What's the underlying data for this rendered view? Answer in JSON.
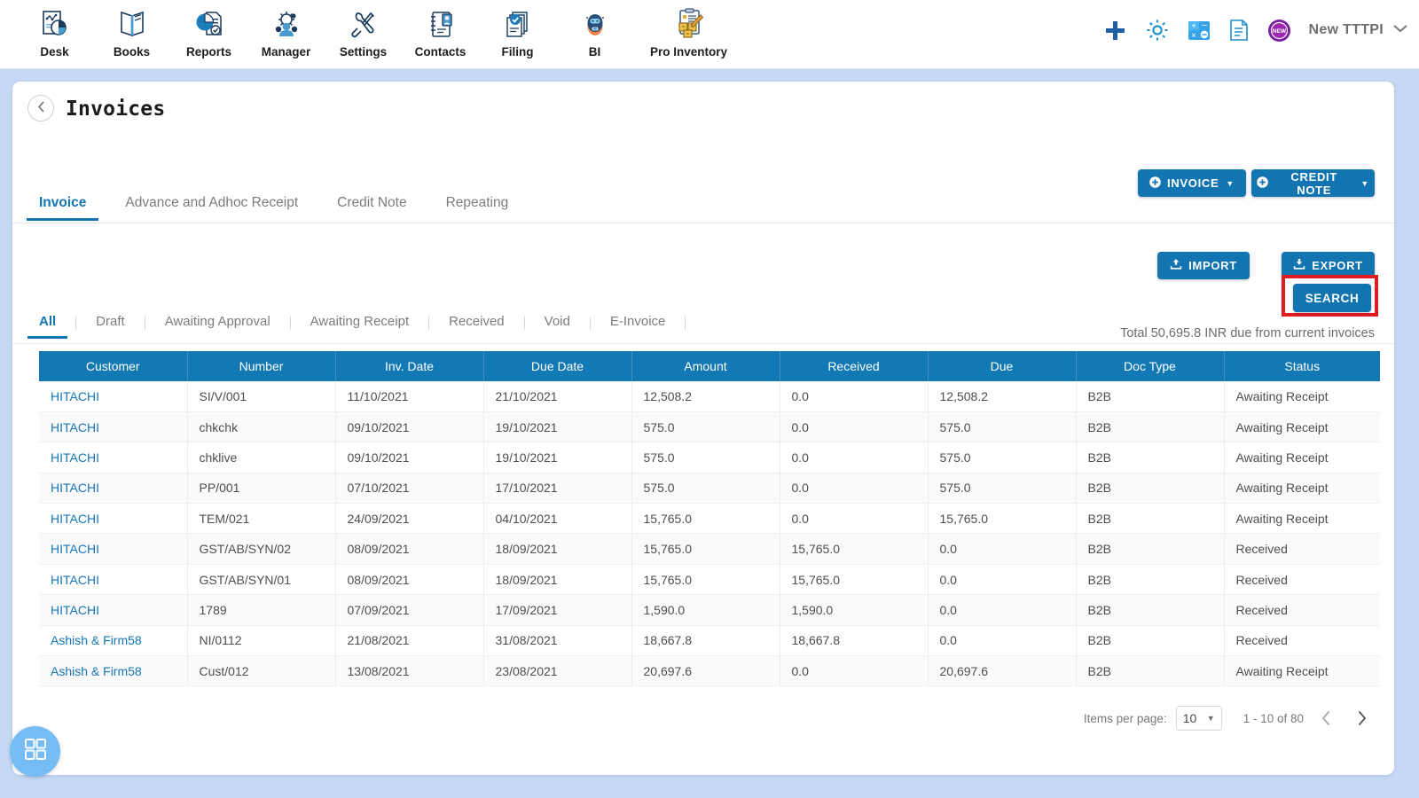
{
  "topnav": {
    "items": [
      {
        "label": "Desk",
        "icon": "dashboard-icon"
      },
      {
        "label": "Books",
        "icon": "books-icon"
      },
      {
        "label": "Reports",
        "icon": "reports-icon"
      },
      {
        "label": "Manager",
        "icon": "manager-icon"
      },
      {
        "label": "Settings",
        "icon": "settings-icon"
      },
      {
        "label": "Contacts",
        "icon": "contacts-icon"
      },
      {
        "label": "Filing",
        "icon": "filing-icon"
      },
      {
        "label": "BI",
        "icon": "bi-robot-icon"
      },
      {
        "label": "Pro Inventory",
        "icon": "pro-inventory-icon"
      }
    ],
    "right": {
      "add_icon": "plus-icon",
      "settings_icon": "gear-icon",
      "calculator_icon": "calculator-icon",
      "notes_icon": "notes-icon",
      "new_badge_icon": "new-badge-icon",
      "org_name": "New TTTPI",
      "org_caret": "chevron-down-icon"
    }
  },
  "page": {
    "back_icon": "chevron-left-icon",
    "title": "Invoices"
  },
  "actions": {
    "invoice_label": "INVOICE",
    "credit_note_label": "CREDIT NOTE",
    "import_label": "IMPORT",
    "export_label": "EXPORT",
    "search_label": "SEARCH",
    "plus_icon": "circle-plus-icon",
    "caret": "▼",
    "upload_icon": "upload-icon"
  },
  "main_tabs": [
    {
      "label": "Invoice",
      "active": true
    },
    {
      "label": "Advance and Adhoc Receipt",
      "active": false
    },
    {
      "label": "Credit Note",
      "active": false
    },
    {
      "label": "Repeating",
      "active": false
    }
  ],
  "filter_tabs": [
    {
      "label": "All",
      "active": true
    },
    {
      "label": "Draft",
      "active": false
    },
    {
      "label": "Awaiting Approval",
      "active": false
    },
    {
      "label": "Awaiting Receipt",
      "active": false
    },
    {
      "label": "Received",
      "active": false
    },
    {
      "label": "Void",
      "active": false
    },
    {
      "label": "E-Invoice",
      "active": false
    }
  ],
  "summary": {
    "total_text": "Total 50,695.8 INR due from current invoices"
  },
  "table": {
    "columns": [
      "Customer",
      "Number",
      "Inv. Date",
      "Due Date",
      "Amount",
      "Received",
      "Due",
      "Doc Type",
      "Status"
    ],
    "rows": [
      {
        "customer": "HITACHI",
        "number": "SI/V/001",
        "inv_date": "11/10/2021",
        "due_date": "21/10/2021",
        "amount": "12,508.2",
        "received": "0.0",
        "due": "12,508.2",
        "doc_type": "B2B",
        "status": "Awaiting Receipt"
      },
      {
        "customer": "HITACHI",
        "number": "chkchk",
        "inv_date": "09/10/2021",
        "due_date": "19/10/2021",
        "amount": "575.0",
        "received": "0.0",
        "due": "575.0",
        "doc_type": "B2B",
        "status": "Awaiting Receipt"
      },
      {
        "customer": "HITACHI",
        "number": "chklive",
        "inv_date": "09/10/2021",
        "due_date": "19/10/2021",
        "amount": "575.0",
        "received": "0.0",
        "due": "575.0",
        "doc_type": "B2B",
        "status": "Awaiting Receipt"
      },
      {
        "customer": "HITACHI",
        "number": "PP/001",
        "inv_date": "07/10/2021",
        "due_date": "17/10/2021",
        "amount": "575.0",
        "received": "0.0",
        "due": "575.0",
        "doc_type": "B2B",
        "status": "Awaiting Receipt"
      },
      {
        "customer": "HITACHI",
        "number": "TEM/021",
        "inv_date": "24/09/2021",
        "due_date": "04/10/2021",
        "amount": "15,765.0",
        "received": "0.0",
        "due": "15,765.0",
        "doc_type": "B2B",
        "status": "Awaiting Receipt"
      },
      {
        "customer": "HITACHI",
        "number": "GST/AB/SYN/02",
        "inv_date": "08/09/2021",
        "due_date": "18/09/2021",
        "amount": "15,765.0",
        "received": "15,765.0",
        "due": "0.0",
        "doc_type": "B2B",
        "status": "Received"
      },
      {
        "customer": "HITACHI",
        "number": "GST/AB/SYN/01",
        "inv_date": "08/09/2021",
        "due_date": "18/09/2021",
        "amount": "15,765.0",
        "received": "15,765.0",
        "due": "0.0",
        "doc_type": "B2B",
        "status": "Received"
      },
      {
        "customer": "HITACHI",
        "number": "1789",
        "inv_date": "07/09/2021",
        "due_date": "17/09/2021",
        "amount": "1,590.0",
        "received": "1,590.0",
        "due": "0.0",
        "doc_type": "B2B",
        "status": "Received"
      },
      {
        "customer": "Ashish & Firm58",
        "number": "NI/0112",
        "inv_date": "21/08/2021",
        "due_date": "31/08/2021",
        "amount": "18,667.8",
        "received": "18,667.8",
        "due": "0.0",
        "doc_type": "B2B",
        "status": "Received"
      },
      {
        "customer": "Ashish & Firm58",
        "number": "Cust/012",
        "inv_date": "13/08/2021",
        "due_date": "23/08/2021",
        "amount": "20,697.6",
        "received": "0.0",
        "due": "20,697.6",
        "doc_type": "B2B",
        "status": "Awaiting Receipt"
      }
    ]
  },
  "pagination": {
    "items_per_page_label": "Items per page:",
    "items_per_page_value": "10",
    "range_text": "1 - 10 of 80",
    "prev_icon": "chevron-left-icon",
    "next_icon": "chevron-right-icon"
  },
  "fab": {
    "icon": "grid-apps-icon"
  },
  "colors": {
    "accent": "#1274b0",
    "header_blue": "#1279b5",
    "page_bg": "#c5d9f5",
    "highlight_red": "#e11b22",
    "link_blue": "#1675b5",
    "fab_blue": "#77bdf5"
  }
}
